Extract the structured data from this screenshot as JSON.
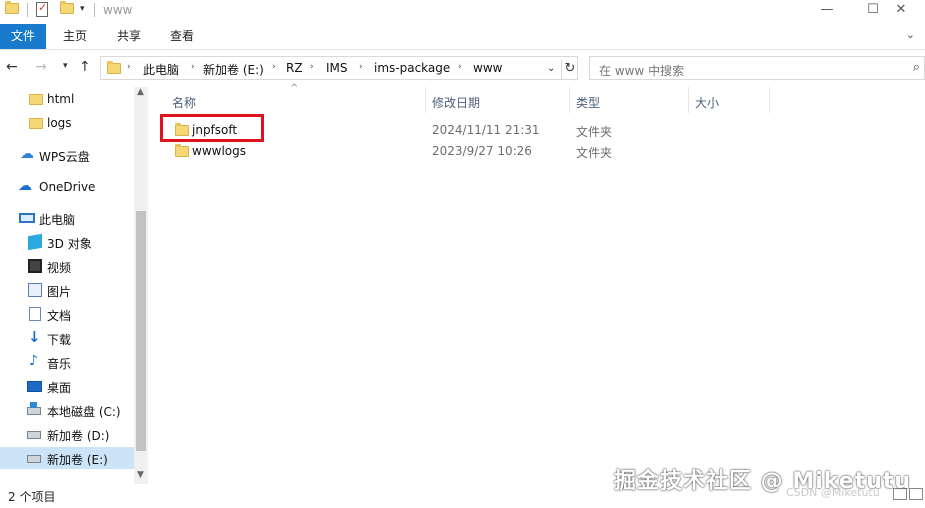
{
  "window": {
    "title": "www",
    "controls": {
      "minimize": "—",
      "maximize": "☐",
      "close": "✕"
    }
  },
  "ribbon": {
    "tabs": [
      "文件",
      "主页",
      "共享",
      "查看"
    ]
  },
  "address": {
    "crumbs": [
      "此电脑",
      "新加卷 (E:)",
      "RZ",
      "IMS",
      "ims-package",
      "www"
    ]
  },
  "search": {
    "placeholder": "在 www 中搜索"
  },
  "sidebar": {
    "items": [
      {
        "label": "html",
        "icon": "folder-icon"
      },
      {
        "label": "logs",
        "icon": "folder-icon"
      },
      {
        "label": "WPS云盘",
        "icon": "cloud-icon"
      },
      {
        "label": "OneDrive",
        "icon": "onedrive-icon"
      },
      {
        "label": "此电脑",
        "icon": "computer-icon"
      },
      {
        "label": "3D 对象",
        "icon": "3d-objects-icon"
      },
      {
        "label": "视频",
        "icon": "video-icon"
      },
      {
        "label": "图片",
        "icon": "pictures-icon"
      },
      {
        "label": "文档",
        "icon": "documents-icon"
      },
      {
        "label": "下载",
        "icon": "download-icon"
      },
      {
        "label": "音乐",
        "icon": "music-icon"
      },
      {
        "label": "桌面",
        "icon": "desktop-icon"
      },
      {
        "label": "本地磁盘 (C:)",
        "icon": "windows-drive-icon"
      },
      {
        "label": "新加卷 (D:)",
        "icon": "drive-icon"
      },
      {
        "label": "新加卷 (E:)",
        "icon": "drive-icon",
        "selected": true
      }
    ]
  },
  "columns": {
    "name": "名称",
    "modified": "修改日期",
    "type": "类型",
    "size": "大小"
  },
  "files": [
    {
      "name": "jnpfsoft",
      "modified": "2024/11/11 21:31",
      "type": "文件夹",
      "highlighted": true
    },
    {
      "name": "wwwlogs",
      "modified": "2023/9/27 10:26",
      "type": "文件夹"
    }
  ],
  "status": {
    "item_count": "2 个项目"
  },
  "watermark": {
    "main": "掘金技术社区 @ Miketutu",
    "sub": "CSDN @Miketutu"
  }
}
